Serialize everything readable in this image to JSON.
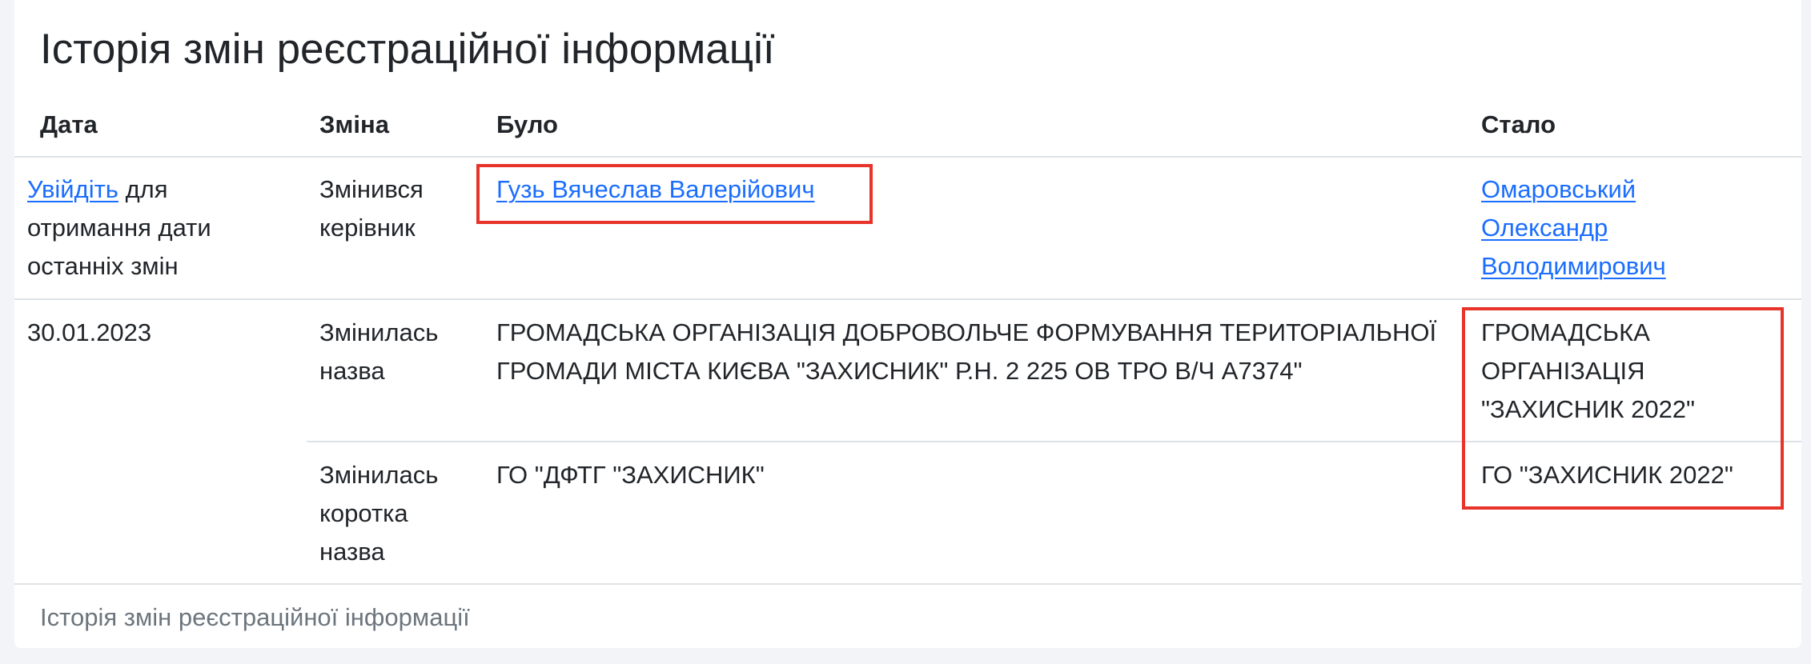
{
  "title": "Історія змін реєстраційної інформації",
  "columns": {
    "date": "Дата",
    "change": "Зміна",
    "was": "Було",
    "became": "Стало"
  },
  "rows": [
    {
      "date_link": "Увійдіть",
      "date_text_1": " для",
      "date_text_2": "отримання дати",
      "date_text_3": "останніх змін",
      "change_1": "Змінився",
      "change_2": "керівник",
      "was_link": "Гузь Вячеслав Валерійович",
      "became_link_1": "Омаровський",
      "became_link_2": "Олександр",
      "became_link_3": "Володимирович"
    },
    {
      "date": "30.01.2023",
      "change_1": "Змінилась",
      "change_2": "назва",
      "was_1": "ГРОМАДСЬКА ОРГАНІЗАЦІЯ ДОБРОВОЛЬЧЕ ФОРМУВАННЯ ТЕРИТОРІАЛЬНОЇ",
      "was_2": "ГРОМАДИ МІСТА КИЄВА \"ЗАХИСНИК\" Р.Н. 2 225 ОВ ТРО В/Ч А7374\"",
      "became_1": "ГРОМАДСЬКА",
      "became_2": "ОРГАНІЗАЦІЯ",
      "became_3": "\"ЗАХИСНИК 2022\""
    },
    {
      "change_1": "Змінилась",
      "change_2": "коротка",
      "change_3": "назва",
      "was": "ГО \"ДФТГ \"ЗАХИСНИК\"",
      "became": "ГО \"ЗАХИСНИК 2022\""
    }
  ],
  "caption": "Історія змін реєстраційної інформації",
  "colors": {
    "link": "#1a6dff",
    "highlight": "#e8332a",
    "border": "#dee2e6",
    "muted": "#6c757d"
  }
}
